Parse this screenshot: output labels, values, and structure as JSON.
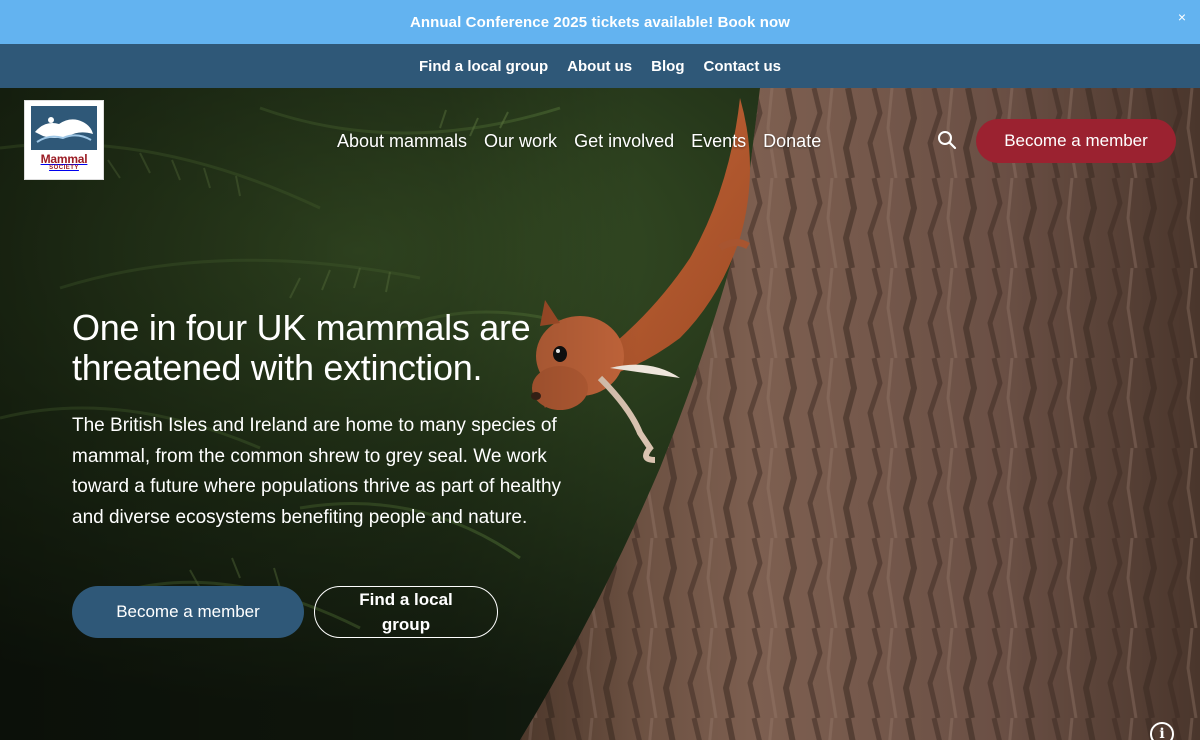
{
  "announcement": {
    "text": "Annual Conference 2025 tickets available! Book now",
    "close_symbol": "×"
  },
  "utility_nav": {
    "items": [
      {
        "label": "Find a local group"
      },
      {
        "label": "About us"
      },
      {
        "label": "Blog"
      },
      {
        "label": "Contact us"
      }
    ]
  },
  "logo": {
    "wordmark": "Mammal",
    "subtitle": "SOCIETY"
  },
  "main_nav": {
    "items": [
      {
        "label": "About mammals"
      },
      {
        "label": "Our work"
      },
      {
        "label": "Get involved"
      },
      {
        "label": "Events"
      },
      {
        "label": "Donate"
      }
    ],
    "search_icon": "search-icon",
    "cta_label": "Become a member"
  },
  "hero": {
    "title": "One in four UK mammals are threatened with extinction.",
    "body": "The British Isles and Ireland are home to many species of mammal, from the common shrew to grey seal. We work toward a future where populations thrive as part of healthy and diverse ecosystems benefiting people and nature.",
    "primary_button": "Become a member",
    "secondary_button": "Find a local group",
    "info_icon": "info-icon",
    "info_symbol": "i"
  },
  "colors": {
    "announcement_bg": "#63b3f0",
    "utility_nav_bg": "#2f5878",
    "cta_red": "#9b2230",
    "primary_blue": "#2f5878",
    "logo_red": "#9b1c24"
  }
}
